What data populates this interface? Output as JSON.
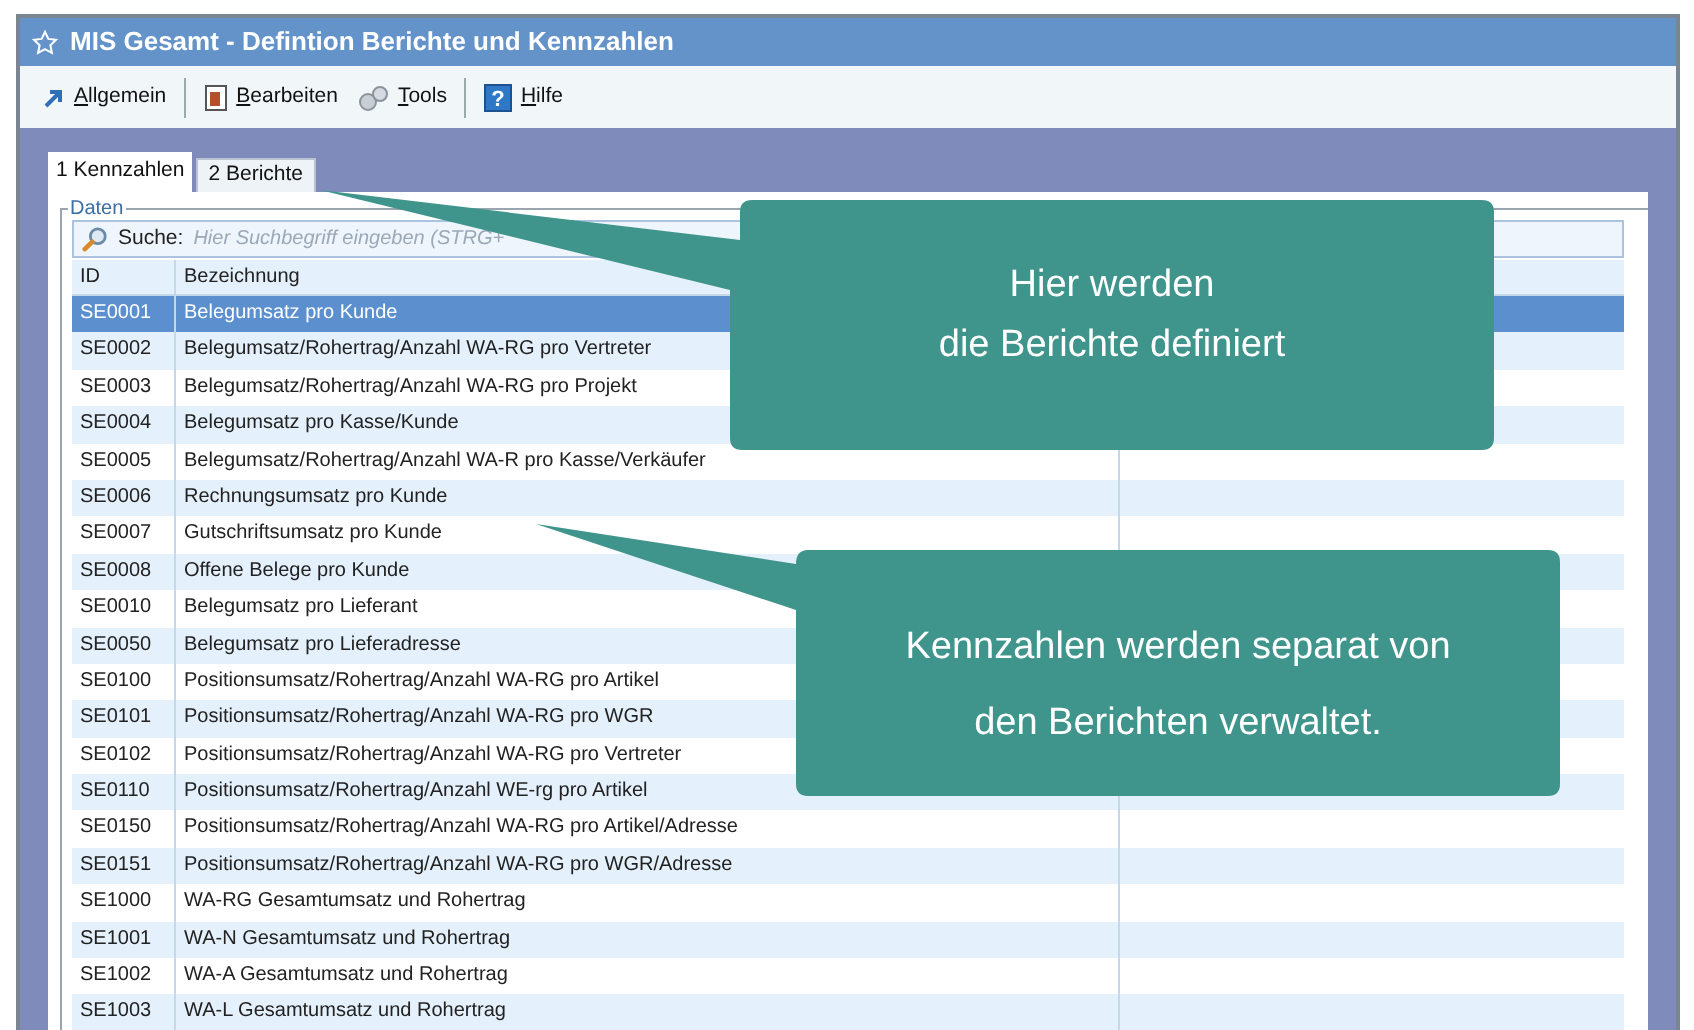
{
  "window": {
    "title": "MIS Gesamt - Defintion Berichte und Kennzahlen"
  },
  "toolbar": [
    {
      "label": "Allgemein",
      "kind": "arrow"
    },
    {
      "label": "Bearbeiten",
      "kind": "edit"
    },
    {
      "label": "Tools",
      "kind": "gears"
    },
    {
      "label": "Hilfe",
      "kind": "help",
      "icon": "?"
    }
  ],
  "tabs": [
    {
      "label": "1 Kennzahlen",
      "selected": true
    },
    {
      "label": "2 Berichte",
      "selected": false
    }
  ],
  "group_label": "Daten",
  "search": {
    "label": "Suche:",
    "placeholder": "Hier Suchbegriff eingeben (STRG+"
  },
  "table": {
    "columns": [
      "ID",
      "Bezeichnung"
    ],
    "rows": [
      {
        "id": "SE0001",
        "name": "Belegumsatz pro Kunde",
        "selected": true
      },
      {
        "id": "SE0002",
        "name": "Belegumsatz/Rohertrag/Anzahl WA-RG pro Vertreter",
        "selected": false
      },
      {
        "id": "SE0003",
        "name": "Belegumsatz/Rohertrag/Anzahl WA-RG pro Projekt",
        "selected": false
      },
      {
        "id": "SE0004",
        "name": "Belegumsatz pro Kasse/Kunde",
        "selected": false
      },
      {
        "id": "SE0005",
        "name": "Belegumsatz/Rohertrag/Anzahl WA-R pro Kasse/Verkäufer",
        "selected": false
      },
      {
        "id": "SE0006",
        "name": "Rechnungsumsatz pro Kunde",
        "selected": false
      },
      {
        "id": "SE0007",
        "name": "Gutschriftsumsatz pro Kunde",
        "selected": false
      },
      {
        "id": "SE0008",
        "name": "Offene Belege pro Kunde",
        "selected": false
      },
      {
        "id": "SE0010",
        "name": "Belegumsatz pro Lieferant",
        "selected": false
      },
      {
        "id": "SE0050",
        "name": "Belegumsatz pro Lieferadresse",
        "selected": false
      },
      {
        "id": "SE0100",
        "name": "Positionsumsatz/Rohertrag/Anzahl WA-RG pro Artikel",
        "selected": false
      },
      {
        "id": "SE0101",
        "name": "Positionsumsatz/Rohertrag/Anzahl WA-RG pro WGR",
        "selected": false
      },
      {
        "id": "SE0102",
        "name": "Positionsumsatz/Rohertrag/Anzahl WA-RG pro Vertreter",
        "selected": false
      },
      {
        "id": "SE0110",
        "name": "Positionsumsatz/Rohertrag/Anzahl WE-rg pro Artikel",
        "selected": false
      },
      {
        "id": "SE0150",
        "name": "Positionsumsatz/Rohertrag/Anzahl WA-RG pro Artikel/Adresse",
        "selected": false
      },
      {
        "id": "SE0151",
        "name": "Positionsumsatz/Rohertrag/Anzahl WA-RG pro WGR/Adresse",
        "selected": false
      },
      {
        "id": "SE1000",
        "name": "WA-RG Gesamtumsatz und Rohertrag",
        "selected": false
      },
      {
        "id": "SE1001",
        "name": "WA-N Gesamtumsatz und Rohertrag",
        "selected": false
      },
      {
        "id": "SE1002",
        "name": "WA-A Gesamtumsatz und Rohertrag",
        "selected": false
      },
      {
        "id": "SE1003",
        "name": "WA-L Gesamtumsatz und Rohertrag",
        "selected": false
      }
    ]
  },
  "callouts": [
    {
      "lines": [
        "Hier werden",
        "die Berichte definiert"
      ]
    },
    {
      "lines": [
        "Kennzahlen werden separat von",
        "den Berichten verwaltet."
      ]
    }
  ]
}
